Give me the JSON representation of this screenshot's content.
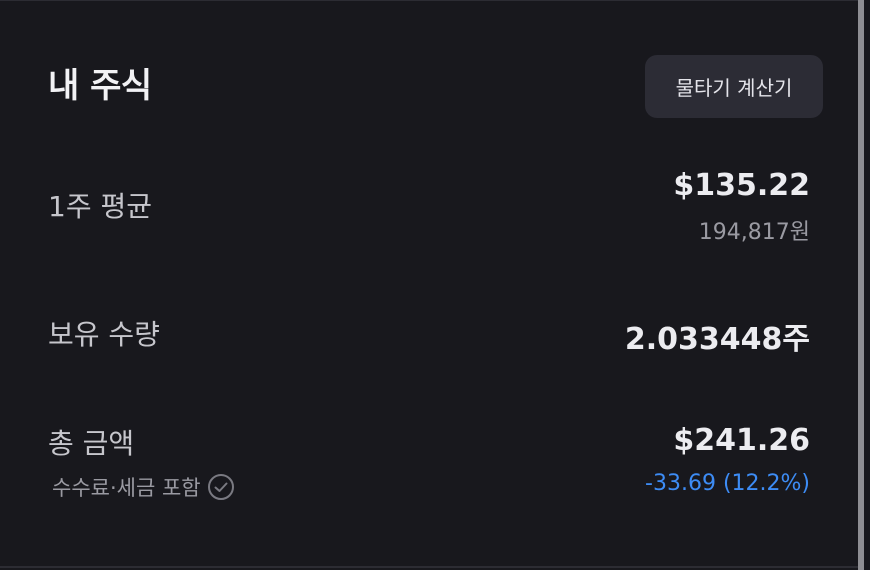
{
  "header": {
    "title": "내 주식",
    "calc_button_label": "물타기 계산기"
  },
  "avg_price": {
    "label": "1주 평균",
    "usd": "$135.22",
    "krw": "194,817원"
  },
  "quantity": {
    "label": "보유 수량",
    "value": "2.033448주"
  },
  "total": {
    "label": "총 금액",
    "usd": "$241.26",
    "fee_note": "수수료·세금 포함",
    "change": "-33.69 (12.2%)"
  },
  "colors": {
    "background": "#18181d",
    "button_bg": "#2c2c35",
    "negative_change": "#3d8cf5"
  },
  "icons": {
    "fee_info": "check-circle-icon"
  }
}
